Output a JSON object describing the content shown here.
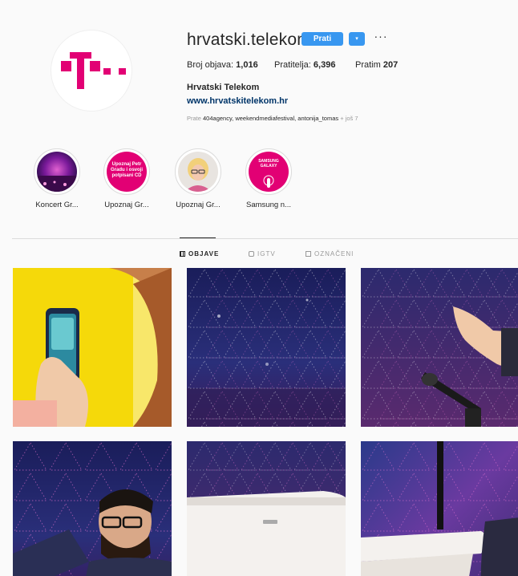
{
  "profile": {
    "username": "hrvatski.telekom",
    "follow_label": "Prati",
    "dropdown_glyph": "▾",
    "more_glyph": "···",
    "full_name": "Hrvatski Telekom",
    "website": "www.hrvatskitelekom.hr",
    "logo_letter": "T",
    "brand_color": "#e20074"
  },
  "stats": {
    "posts_label": "Broj objava: ",
    "posts_value": "1,016",
    "followers_label": "Pratitelja: ",
    "followers_value": "6,396",
    "following_label": "Pratim ",
    "following_value": "207"
  },
  "followed_by": {
    "prefix": "Prate ",
    "names": "404agency, weekendmediafestival, antonija_tomas",
    "more": " + još 7"
  },
  "highlights": [
    {
      "label": "Koncert Gr..."
    },
    {
      "label": "Upoznaj Gr...",
      "cover_text": "Upoznaj Petr Gradu i osvoji potpisani CD"
    },
    {
      "label": "Upoznaj Gr..."
    },
    {
      "label": "Samsung n...",
      "cover_text": "SAMSUNG GALAXY"
    }
  ],
  "tabs": [
    {
      "label": "OBJAVE",
      "icon": "grid-icon",
      "active": true
    },
    {
      "label": "IGTV",
      "icon": "igtv-icon",
      "active": false
    },
    {
      "label": "OZNAČENI",
      "icon": "tagged-icon",
      "active": false
    }
  ],
  "colors": {
    "accent": "#3897f0",
    "link": "#003569",
    "muted": "#999999",
    "border": "#dbdbdb",
    "background": "#fafafa"
  }
}
